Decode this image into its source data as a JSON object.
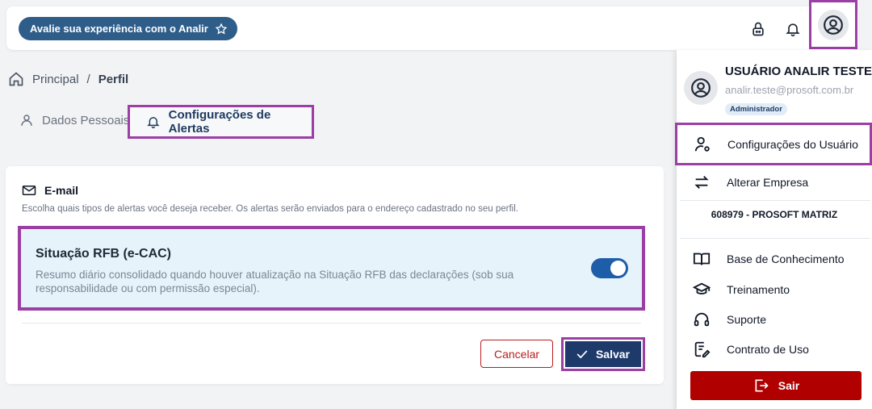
{
  "header": {
    "rate_label": "Avalie sua experiência com o Analir"
  },
  "breadcrumb": {
    "home": "Principal",
    "separator": "/",
    "current": "Perfil"
  },
  "tabs": [
    {
      "label": "Dados Pessoais",
      "icon": "user-icon",
      "active": false
    },
    {
      "label": "Configurações de Alertas",
      "icon": "bell-icon",
      "active": true
    }
  ],
  "email_section": {
    "title": "E-mail",
    "description": "Escolha quais tipos de alertas você deseja receber. Os alertas serão enviados para o endereço cadastrado no seu perfil."
  },
  "alert": {
    "title": "Situação RFB (e-CAC)",
    "description": "Resumo diário consolidado quando houver atualização na Situação RFB das declarações (sob sua responsabilidade ou com permissão especial).",
    "enabled": true
  },
  "actions": {
    "cancel_label": "Cancelar",
    "save_label": "Salvar"
  },
  "user_menu": {
    "name": "USUÁRIO ANALIR TESTE",
    "email": "analir.teste@prosoft.com.br",
    "role": "Administrador",
    "items": [
      {
        "label": "Configurações do Usuário",
        "icon": "user-settings-icon"
      },
      {
        "label": "Alterar Empresa",
        "icon": "swap-icon"
      }
    ],
    "company": "608979 - PROSOFT MATRIZ",
    "links": [
      {
        "label": "Base de Conhecimento",
        "icon": "book-icon"
      },
      {
        "label": "Treinamento",
        "icon": "graduation-cap-icon"
      },
      {
        "label": "Suporte",
        "icon": "headset-icon"
      },
      {
        "label": "Contrato de Uso",
        "icon": "contract-icon"
      }
    ],
    "logout_label": "Sair"
  },
  "colors": {
    "highlight": "#9b3fa5",
    "primary": "#1e3a6b",
    "danger": "#b00000",
    "alert_bg": "#e6f3fb"
  }
}
